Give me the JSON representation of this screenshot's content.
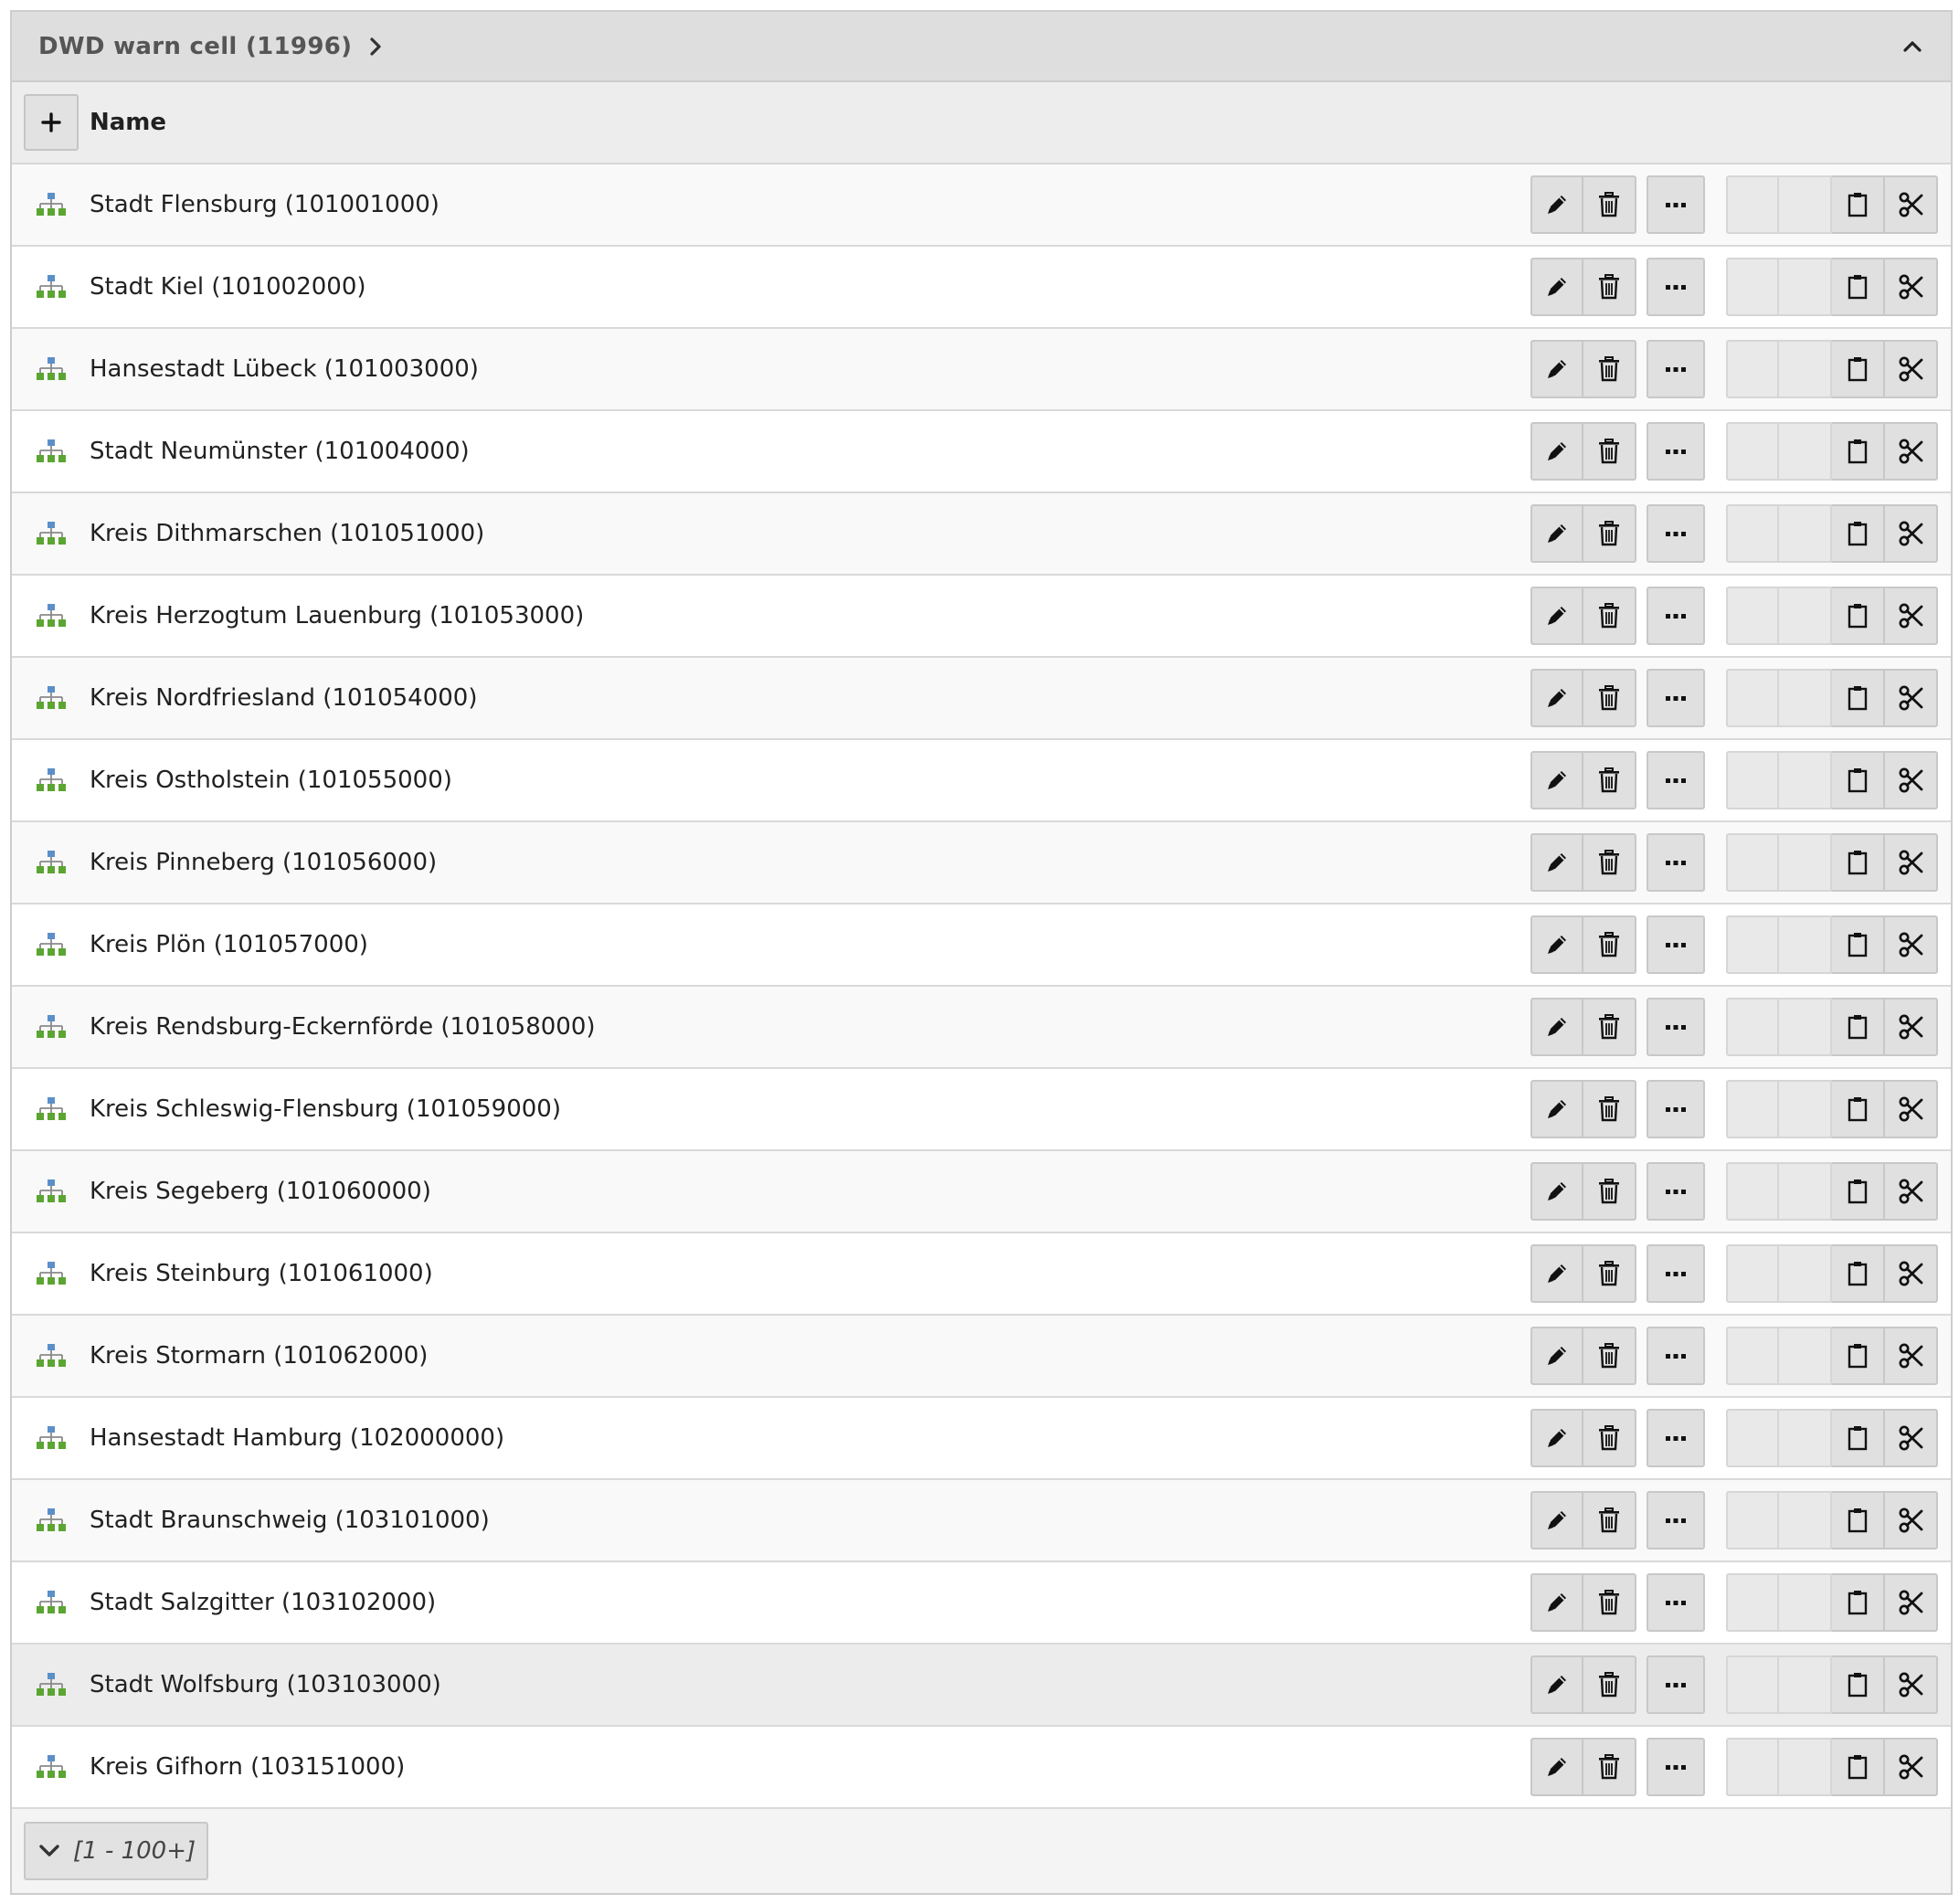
{
  "header": {
    "title": "DWD warn cell (11996)"
  },
  "columns": {
    "name_label": "Name"
  },
  "icons": {
    "row_icon": "tree-hierarchy-icon",
    "edit": "pencil-icon",
    "delete": "trash-icon",
    "more": "ellipsis-icon",
    "paste": "clipboard-icon",
    "cut": "scissors-icon",
    "add": "plus-icon",
    "collapse": "chevron-up-icon",
    "expand_header": "chevron-right-icon",
    "pager": "chevron-down-icon"
  },
  "rows": [
    {
      "label": "Stadt Flensburg (101001000)"
    },
    {
      "label": "Stadt Kiel (101002000)"
    },
    {
      "label": "Hansestadt Lübeck (101003000)"
    },
    {
      "label": "Stadt Neumünster (101004000)"
    },
    {
      "label": "Kreis Dithmarschen (101051000)"
    },
    {
      "label": "Kreis Herzogtum Lauenburg (101053000)"
    },
    {
      "label": "Kreis Nordfriesland (101054000)"
    },
    {
      "label": "Kreis Ostholstein (101055000)"
    },
    {
      "label": "Kreis Pinneberg (101056000)"
    },
    {
      "label": "Kreis Plön (101057000)"
    },
    {
      "label": "Kreis Rendsburg-Eckernförde (101058000)"
    },
    {
      "label": "Kreis Schleswig-Flensburg (101059000)"
    },
    {
      "label": "Kreis Segeberg (101060000)"
    },
    {
      "label": "Kreis Steinburg (101061000)"
    },
    {
      "label": "Kreis Stormarn (101062000)"
    },
    {
      "label": "Hansestadt Hamburg (102000000)"
    },
    {
      "label": "Stadt Braunschweig (103101000)"
    },
    {
      "label": "Stadt Salzgitter (103102000)"
    },
    {
      "label": "Stadt Wolfsburg (103103000)",
      "highlighted": true
    },
    {
      "label": "Kreis Gifhorn (103151000)"
    }
  ],
  "pager": {
    "label": "[1 - 100+]"
  },
  "colors": {
    "header_bg": "#dedede",
    "row_odd_bg": "#f9f9f9",
    "row_even_bg": "#ffffff",
    "row_highlight_bg": "#ececec",
    "button_bg": "#e0e0e0",
    "icon_green": "#5ba532",
    "icon_blue": "#5b8fc9"
  }
}
